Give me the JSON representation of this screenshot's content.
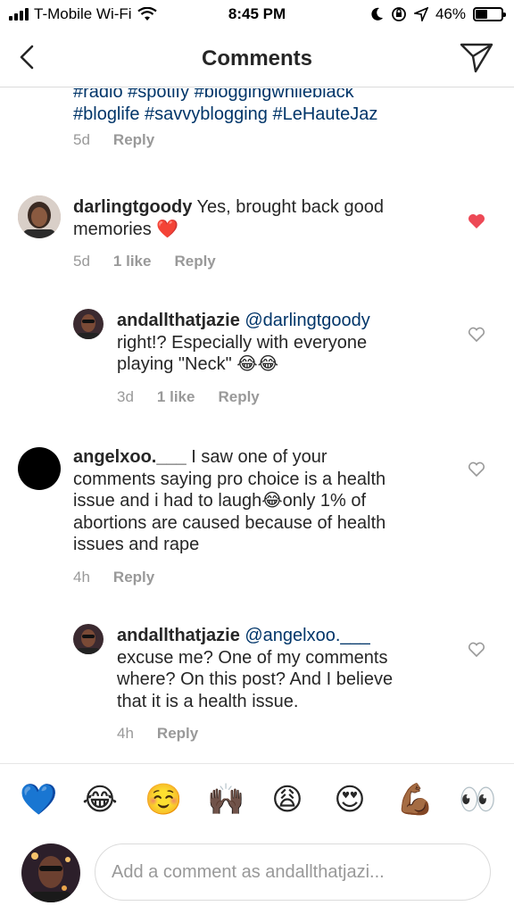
{
  "status_bar": {
    "carrier": "T-Mobile Wi-Fi",
    "time": "8:45 PM",
    "battery": "46%",
    "battery_level": 0.46
  },
  "header": {
    "title": "Comments",
    "back_icon": "chevron-left-icon",
    "share_icon": "paper-plane-icon"
  },
  "comments": [
    {
      "hashtags_line1": "#radio #spotify #bloggingwhileblack",
      "hashtags_line2": "#bloglife #savvyblogging #LeHauteJaz",
      "time": "5d",
      "reply": "Reply"
    },
    {
      "username": "darlingtgoody",
      "text_line1": "Yes, brought back good",
      "text_line2": "memories ❤️",
      "time": "5d",
      "likes": "1 like",
      "reply": "Reply",
      "liked": true
    },
    {
      "username": "andallthatjazie",
      "mention": "@darlingtgoody",
      "text_line1": "right!? Especially with everyone",
      "text_line2": "playing \"Neck\" 😂😂",
      "time": "3d",
      "likes": "1 like",
      "reply": "Reply",
      "liked": false
    },
    {
      "username": "angelxoo.___",
      "text_line1": "I saw one of your",
      "text_line2": "comments saying pro choice is a health",
      "text_line3": "issue and i had to laugh😂only 1% of",
      "text_line4": "abortions are caused because of health",
      "text_line5": "issues and rape",
      "time": "4h",
      "reply": "Reply",
      "liked": false
    },
    {
      "username": "andallthatjazie",
      "mention": "@angelxoo.___",
      "text_line1": "excuse me? One of my comments",
      "text_line2": "where? On this post? And I believe",
      "text_line3": "that it is a health issue.",
      "time": "4h",
      "reply": "Reply",
      "liked": false
    }
  ],
  "emoji_bar": [
    "💙",
    "😂",
    "☺️",
    "🙌🏿",
    "😩",
    "😍",
    "💪🏾",
    "👀"
  ],
  "input": {
    "placeholder": "Add a comment as andallthatjazi..."
  },
  "colors": {
    "heart_liked": "#ed4956",
    "link": "#003569",
    "meta": "#999999"
  }
}
